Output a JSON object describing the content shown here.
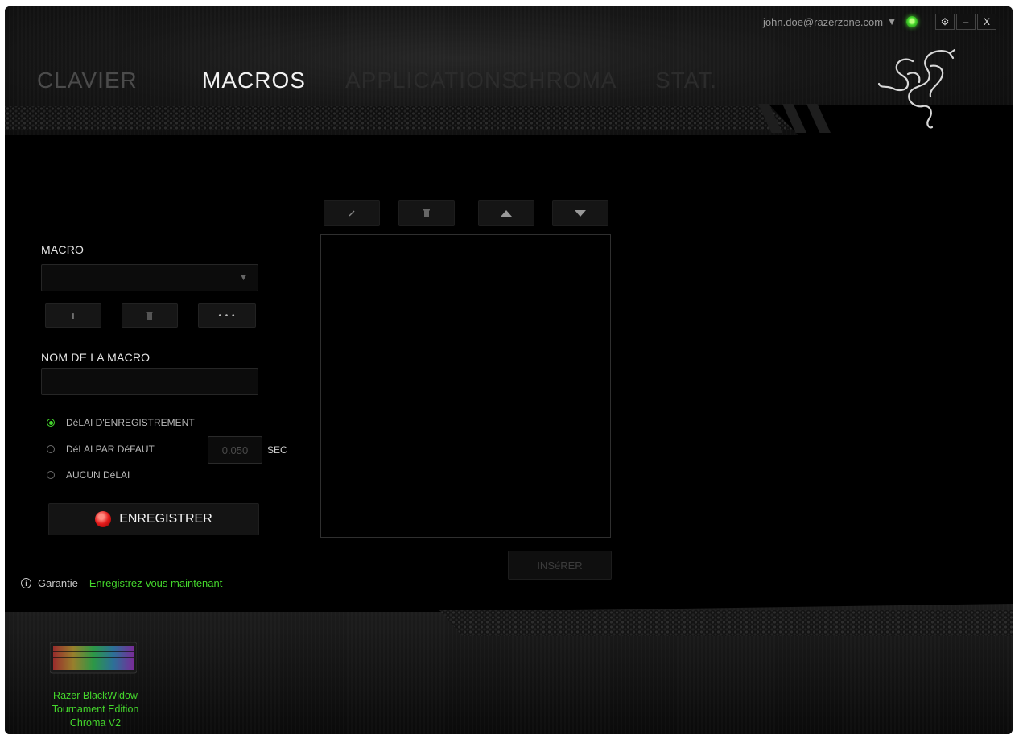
{
  "topbar": {
    "account_email": "john.doe@razerzone.com",
    "caret_icon": "caret-down-icon",
    "status_color": "#44d62c",
    "settings_glyph": "⚙",
    "minimize_glyph": "–",
    "close_glyph": "X"
  },
  "tabs": [
    {
      "label": "CLAVIER",
      "active": false
    },
    {
      "label": "MACROS",
      "active": true
    },
    {
      "label": "APPLICATIONS",
      "active": false
    },
    {
      "label": "CHROMA",
      "active": false
    },
    {
      "label": "STAT.",
      "active": false
    }
  ],
  "macro": {
    "label": "MACRO",
    "selected_value": "",
    "add_glyph": "+",
    "more_glyph": "• • •"
  },
  "macro_name": {
    "label": "NOM DE LA MACRO",
    "value": ""
  },
  "delay_options": [
    {
      "label": "DéLAI D'ENREGISTREMENT",
      "selected": true
    },
    {
      "label": "DéLAI PAR DéFAUT",
      "selected": false
    },
    {
      "label": "AUCUN DéLAI",
      "selected": false
    }
  ],
  "delay_value": "0.050",
  "delay_unit": "SEC",
  "record_button": "ENREGISTRER",
  "warranty": {
    "label": "Garantie",
    "link": "Enregistrez-vous maintenant"
  },
  "insert_button": "INSéRER",
  "device": {
    "name_line1": "Razer BlackWidow",
    "name_line2": "Tournament Edition",
    "name_line3": "Chroma V2"
  },
  "colors": {
    "accent_green": "#44d62c",
    "record_red": "#e31b1b"
  }
}
